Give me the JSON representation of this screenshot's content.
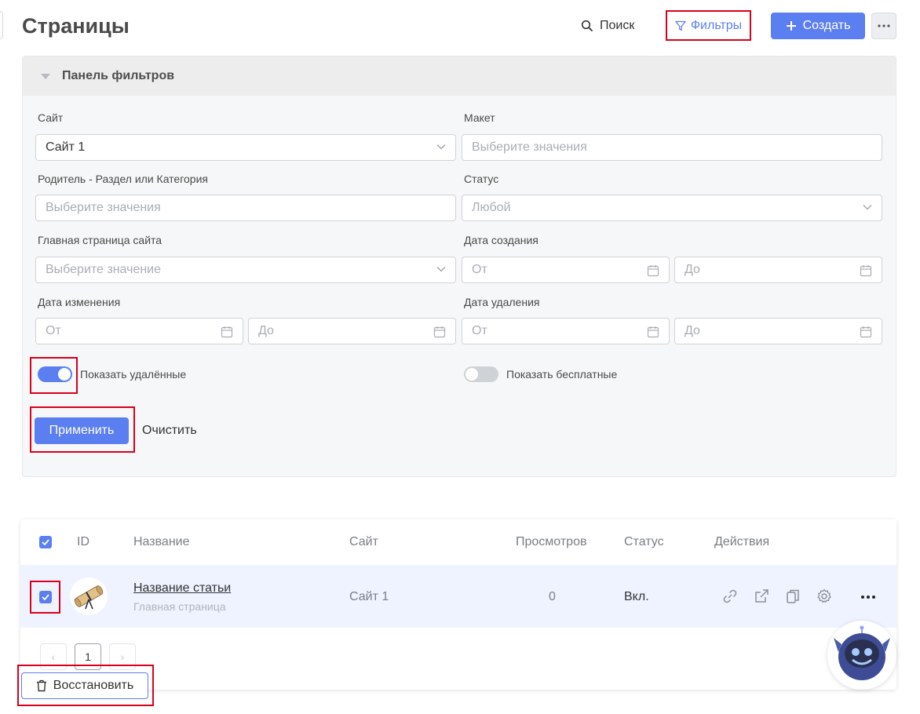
{
  "header": {
    "title": "Страницы",
    "search_label": "Поиск",
    "filters_label": "Фильтры",
    "create_label": "Создать"
  },
  "filter_panel": {
    "title": "Панель фильтров",
    "site": {
      "label": "Сайт",
      "value": "Сайт 1"
    },
    "layout": {
      "label": "Макет",
      "placeholder": "Выберите значения"
    },
    "parent": {
      "label": "Родитель - Раздел или Категория",
      "placeholder": "Выберите значения"
    },
    "status": {
      "label": "Статус",
      "value": "Любой"
    },
    "homepage": {
      "label": "Главная страница сайта",
      "placeholder": "Выберите значение"
    },
    "created": {
      "label": "Дата создания",
      "from": "От",
      "to": "До"
    },
    "modified": {
      "label": "Дата изменения",
      "from": "От",
      "to": "До"
    },
    "deleted": {
      "label": "Дата удаления",
      "from": "От",
      "to": "До"
    },
    "show_deleted": {
      "label": "Показать удалённые",
      "on": true
    },
    "show_free": {
      "label": "Показать бесплатные",
      "on": false
    },
    "apply_label": "Применить",
    "clear_label": "Очистить"
  },
  "table": {
    "columns": [
      "ID",
      "Название",
      "Сайт",
      "Просмотров",
      "Статус",
      "Действия"
    ],
    "rows": [
      {
        "checked": true,
        "title": "Название статьи",
        "subtitle": "Главная страница",
        "site": "Сайт 1",
        "views": "0",
        "status": "Вкл."
      }
    ]
  },
  "pagination": {
    "current": "1",
    "prev": "‹",
    "next": "›"
  },
  "restore_label": "Восстановить",
  "colors": {
    "accent": "#5b7ff0",
    "highlight": "#d9001b"
  }
}
